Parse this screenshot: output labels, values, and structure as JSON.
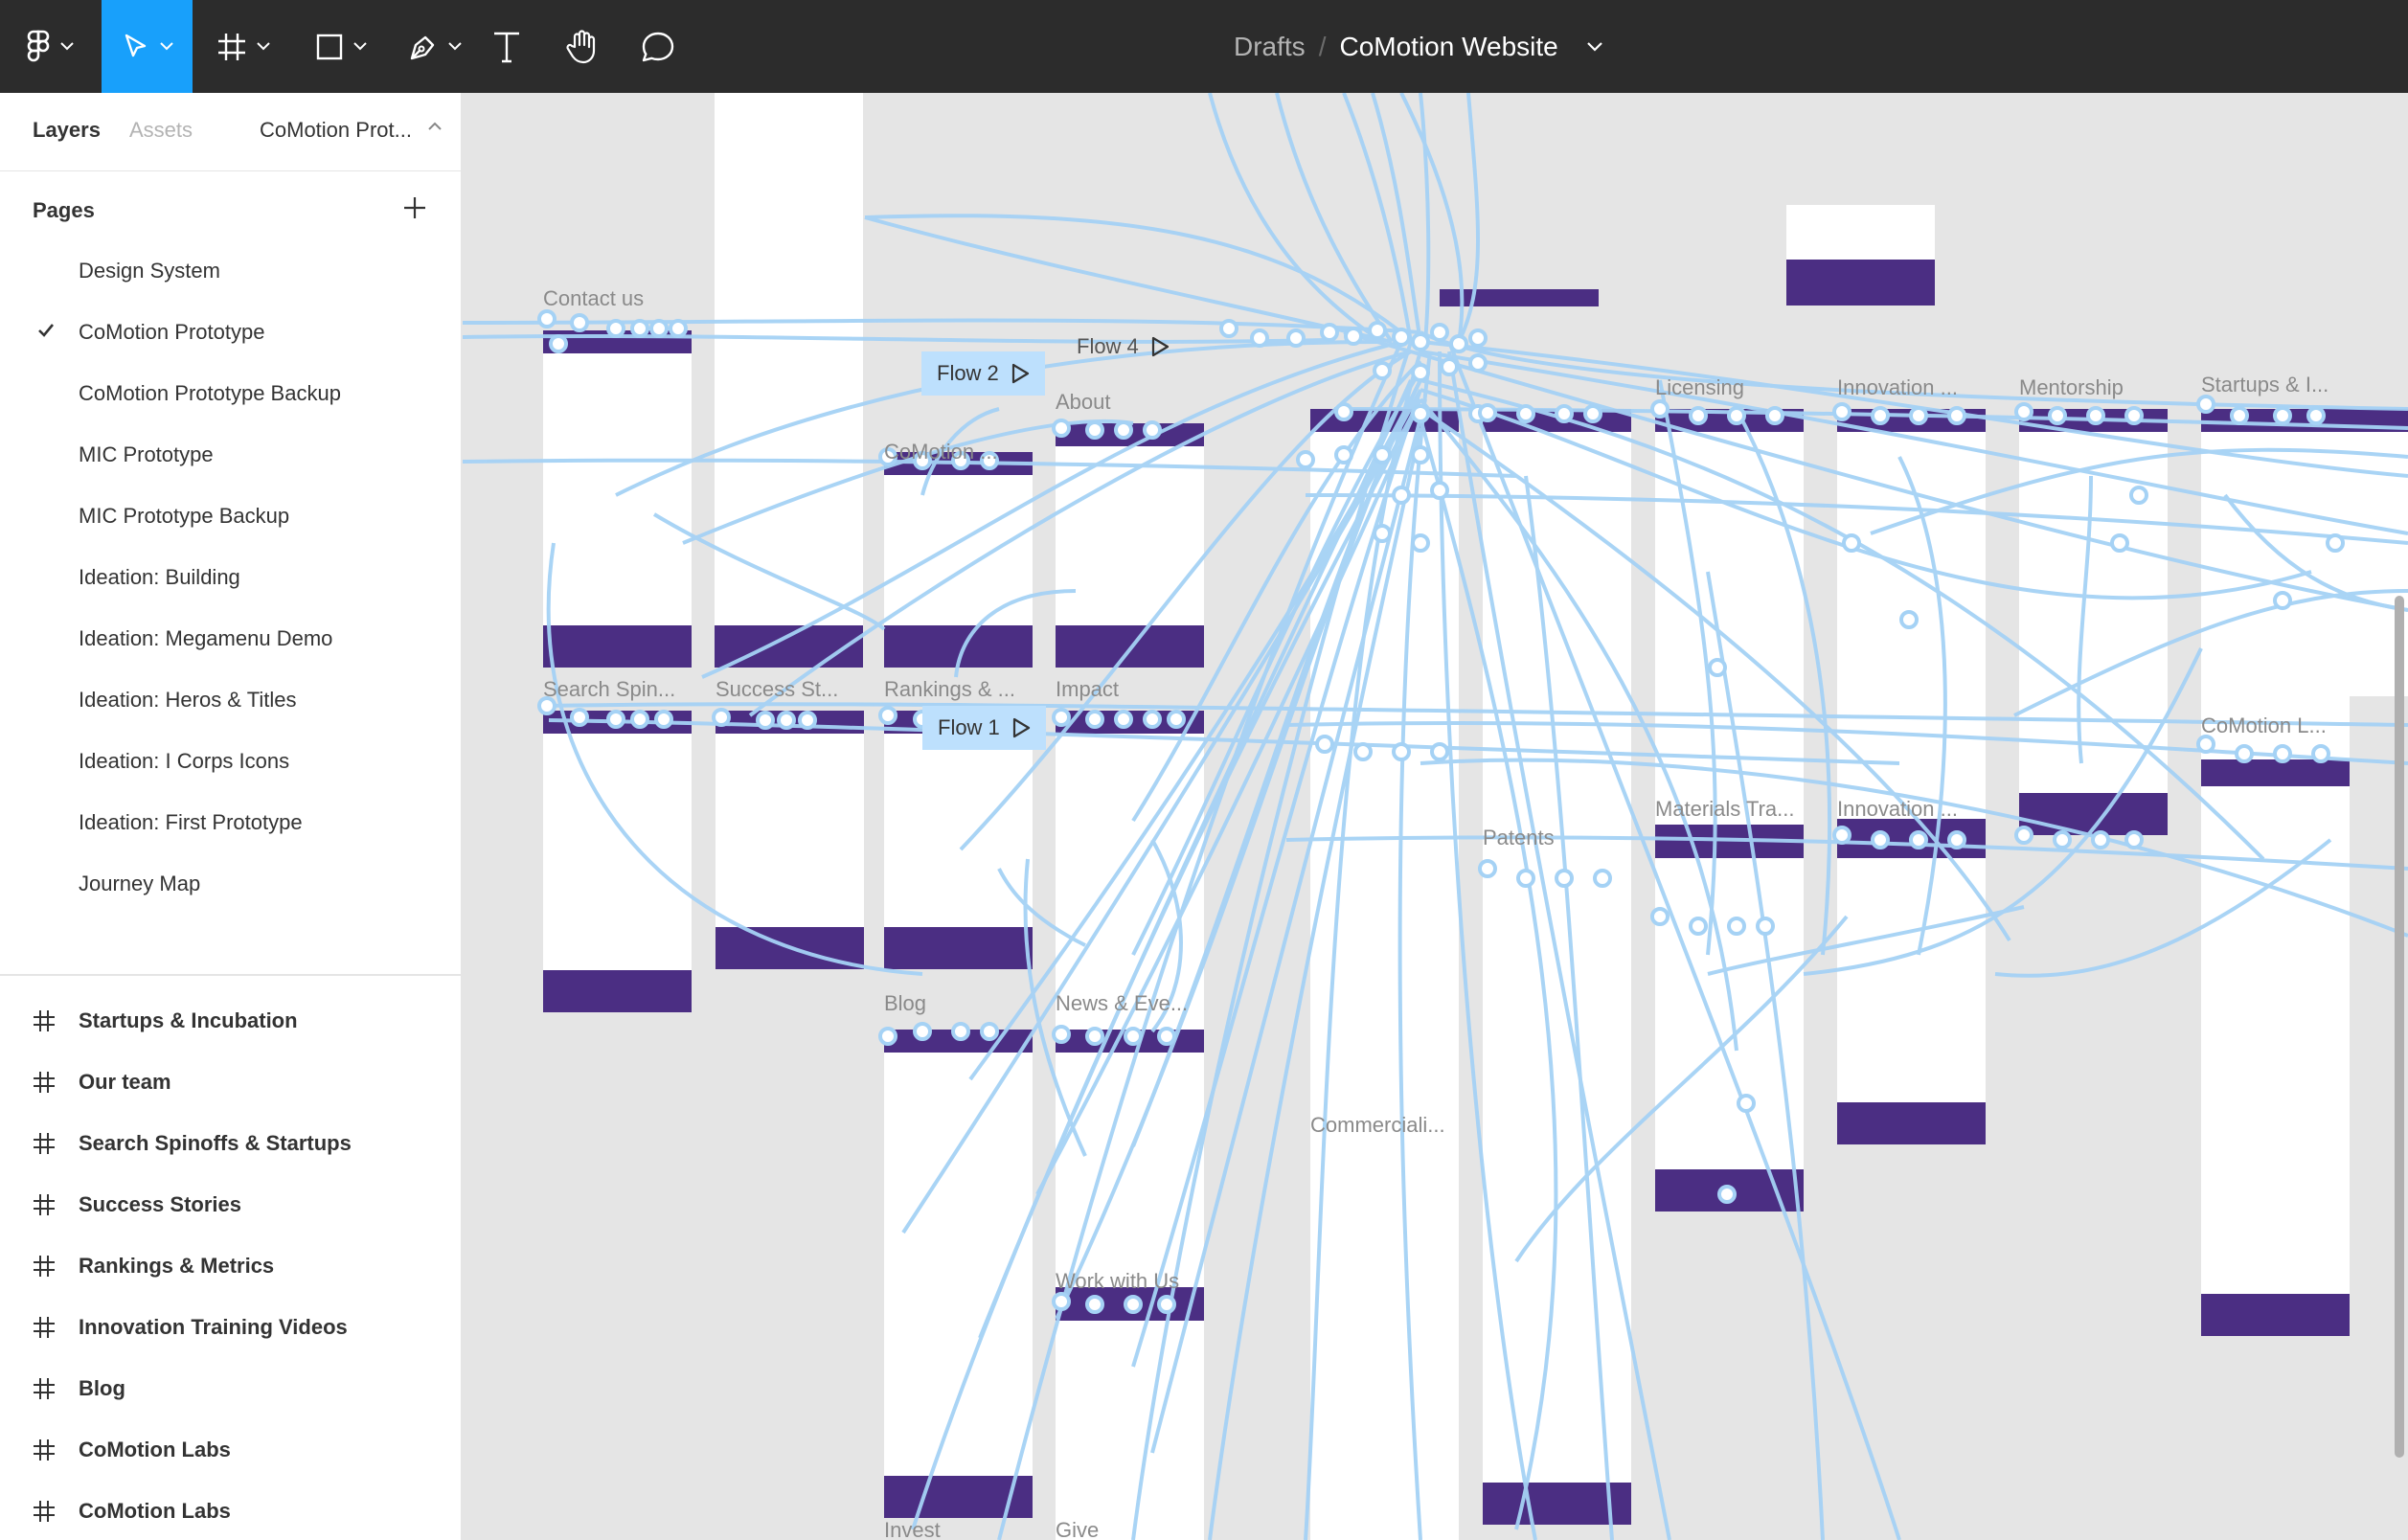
{
  "toolbar": {
    "tools": [
      "main-menu",
      "move",
      "frame",
      "shape",
      "pen",
      "text",
      "hand",
      "comment"
    ],
    "breadcrumb_parent": "Drafts",
    "breadcrumb_separator": "/",
    "file_name": "CoMotion Website",
    "accent_color": "#18a0fb"
  },
  "sidebar": {
    "tab_layers": "Layers",
    "tab_assets": "Assets",
    "current_page": "CoMotion Prot...",
    "pages_heading": "Pages",
    "pages": [
      {
        "label": "Design System",
        "selected": false
      },
      {
        "label": "CoMotion Prototype",
        "selected": true
      },
      {
        "label": "CoMotion Prototype Backup",
        "selected": false
      },
      {
        "label": "MIC Prototype",
        "selected": false
      },
      {
        "label": "MIC Prototype Backup",
        "selected": false
      },
      {
        "label": "Ideation: Building",
        "selected": false
      },
      {
        "label": "Ideation: Megamenu Demo",
        "selected": false
      },
      {
        "label": "Ideation: Heros & Titles",
        "selected": false
      },
      {
        "label": "Ideation: I Corps Icons",
        "selected": false
      },
      {
        "label": "Ideation: First Prototype",
        "selected": false
      },
      {
        "label": "Journey Map",
        "selected": false
      }
    ],
    "frames": [
      "Startups & Incubation",
      "Our team",
      "Search Spinoffs & Startups",
      "Success Stories",
      "Rankings & Metrics",
      "Innovation Training Videos",
      "Blog",
      "CoMotion Labs",
      "CoMotion Labs"
    ]
  },
  "canvas": {
    "frame_labels": [
      "Contact us",
      "Search Spin...",
      "Success St...",
      "CoMotion ...",
      "Rankings & ...",
      "About",
      "Impact",
      "Blog",
      "News & Eve...",
      "Work with Us",
      "Licensing",
      "Innovation ...",
      "Mentorship",
      "Startups & I...",
      "Patents",
      "Materials Tra...",
      "Innovation ...",
      "CoMotion L...",
      "Commerciali...",
      "Invest",
      "Give"
    ],
    "flows": [
      "Flow 2",
      "Flow 1",
      "Flow 4"
    ],
    "wire_color": "#a5d2f5",
    "frame_accent": "#4b2e83"
  }
}
